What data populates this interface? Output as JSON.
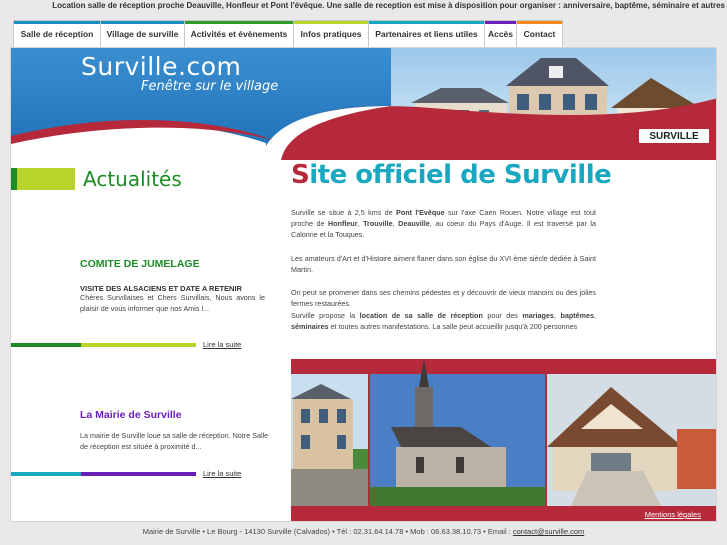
{
  "ticker": "Location salle de réception proche Deauville, Honfleur et Pont l'évêque. Une salle de reception est mise à disposition pour organiser : anniversaire, baptême, séminaire et autres",
  "nav": [
    {
      "label": "Salle de réception",
      "color": "#1a8fc4"
    },
    {
      "label": "Village de surville",
      "color": "#1a8fc4"
    },
    {
      "label": "Activités et évènements",
      "color": "#2e9d2e"
    },
    {
      "label": "Infos pratiques",
      "color": "#b9d22c"
    },
    {
      "label": "Partenaires et liens utiles",
      "color": "#1aa7c0"
    },
    {
      "label": "Accès",
      "color": "#6a1fb8"
    },
    {
      "label": "Contact",
      "color": "#f08a1f"
    }
  ],
  "banner": {
    "site": "Surville.com",
    "tagline": "Fenêtre sur le village",
    "sign": "SURVILLE"
  },
  "news": {
    "heading": "Actualités",
    "items": [
      {
        "title": "COMITE DE JUMELAGE",
        "subtitle": "VISITE DES ALSACIENS ET DATE A RETENIR",
        "body": "Chères Survillaises et Chers Survillais, Nous avons le plaisir de vous informer que nos Amis l...",
        "more": "Lire la suite"
      },
      {
        "title": "La Mairie de Surville",
        "body": "La mairie de Surville loue sa salle de réception. Notre Salle de réception est située à proximité d...",
        "more": "Lire la suite"
      }
    ]
  },
  "main": {
    "title_first": "S",
    "title_rest": "ite officiel de Surville",
    "p1": {
      "a": "Surville se situe à 2,5 kms de ",
      "b": "Pont l'Evêque",
      "c": " sur l'axe Caen Rouen. Notre village est tout proche de ",
      "d": "Honfleur",
      "e": ", ",
      "f": "Trouville",
      "g": ", ",
      "h": "Deauville",
      "i": ", au coeur du Pays d'Auge. Il est traversé par la Calonne et la Touques."
    },
    "p2": "Les amateurs d'Art et d'Histoire aiment flaner dans son église du XVI ème siècle dédiée à Saint Martin.",
    "p3": "On peut se promener dans ses chemins pédestes et y découvrir de vieux manoirs ou des jolies fermes restaurées.",
    "p4": {
      "a": "Surville propose la ",
      "b": "location de sa salle de réception",
      "c": " pour des ",
      "d": "mariages",
      "e": ", ",
      "f": "baptêmes",
      "g": ", ",
      "h": "séminaires",
      "i": " et toutes autres manifestations. La salle peut accueillir jusqu'à 200 personnes"
    },
    "legal": "Mentions légales"
  },
  "footer": {
    "text": "Mairie de Surville • Le Bourg - 14130 Surville (Calvados) • Tél : 02.31.64.14.78 • Mob : 06.63.38.10.73 • Email : ",
    "email": "contact@surville.com"
  },
  "colors": {
    "red": "#b5293a",
    "blue": "#1e6fb3",
    "green": "#1d8c25",
    "lime": "#b9d22c",
    "purple": "#6a1fb8",
    "teal": "#1aa7c0"
  }
}
